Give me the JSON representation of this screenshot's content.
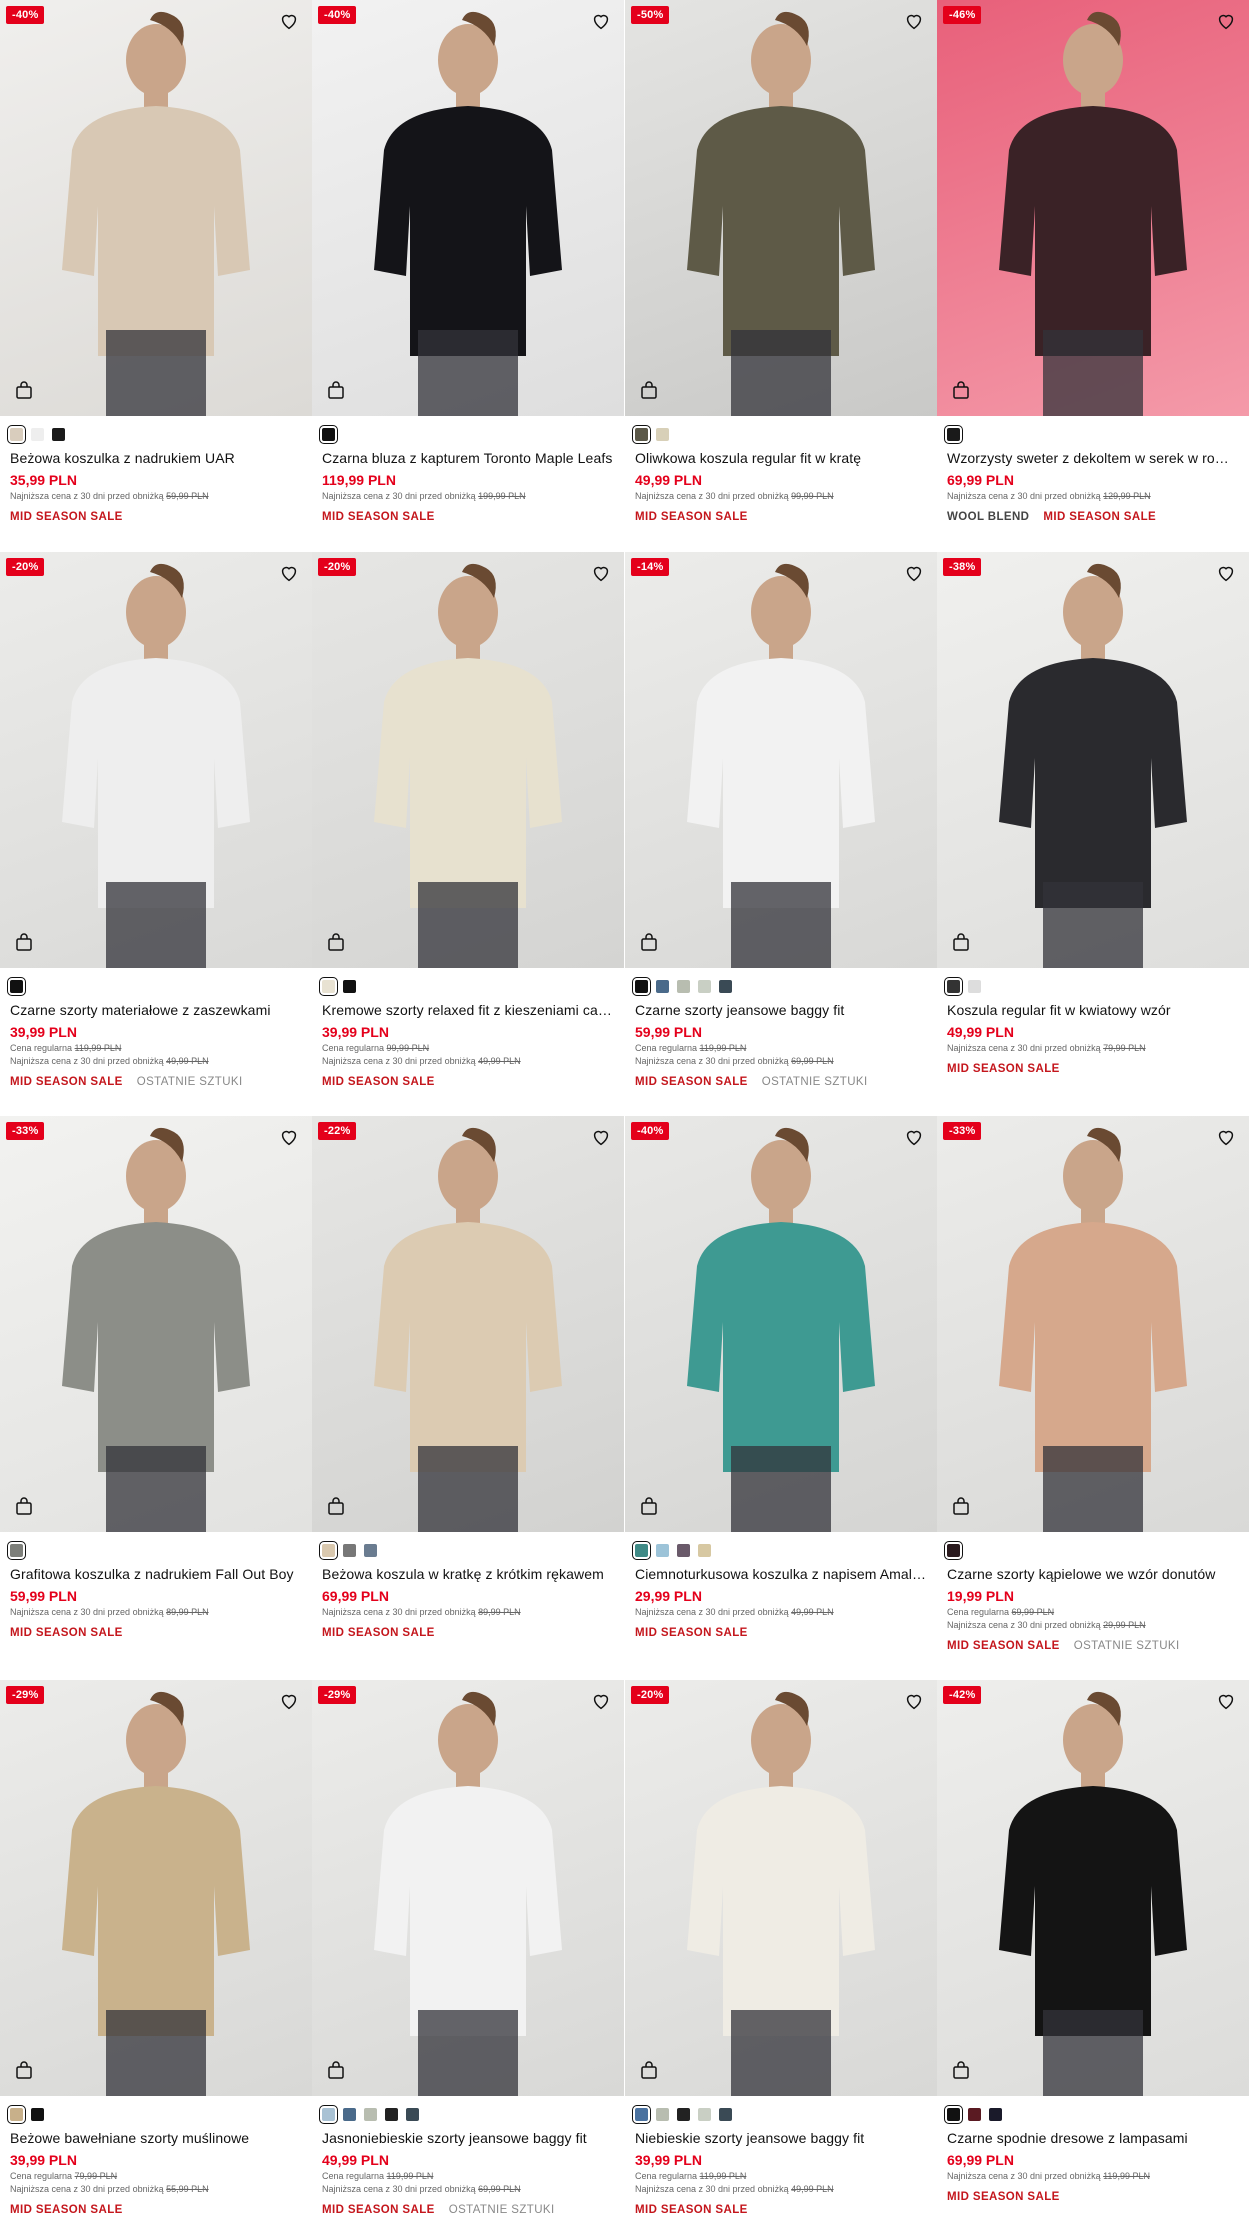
{
  "products": [
    {
      "discount": "-40%",
      "name": "Beżowa koszulka z nadrukiem UAR",
      "price": "35,99 PLN",
      "regular": "",
      "lowest_label": "Najniższa cena z 30 dni przed obniżką",
      "lowest": "59,99 PLN",
      "tags": [
        "MID SEASON SALE"
      ],
      "swatches": [
        "#d9cdbd",
        "#eeeeee",
        "#1a1a1a"
      ],
      "bg": "linear-gradient(160deg,#f0efed,#dcdad6)",
      "figure": "#d8c8b4"
    },
    {
      "discount": "-40%",
      "name": "Czarna bluza z kapturem Toronto Maple Leafs",
      "price": "119,99 PLN",
      "regular": "",
      "lowest_label": "Najniższa cena z 30 dni przed obniżką",
      "lowest": "199,99 PLN",
      "tags": [
        "MID SEASON SALE"
      ],
      "swatches": [
        "#111111"
      ],
      "bg": "linear-gradient(160deg,#f2f2f2,#dedede)",
      "figure": "#141418"
    },
    {
      "discount": "-50%",
      "name": "Oliwkowa koszula regular fit w kratę",
      "price": "49,99 PLN",
      "regular": "",
      "lowest_label": "Najniższa cena z 30 dni przed obniżką",
      "lowest": "99,99 PLN",
      "tags": [
        "MID SEASON SALE"
      ],
      "swatches": [
        "#5b5848",
        "#d8d0b8"
      ],
      "bg": "linear-gradient(160deg,#e4e4e2,#c9c9c7)",
      "figure": "#5e5a47"
    },
    {
      "discount": "-46%",
      "name": "Wzorzysty sweter z dekoltem w serek w ro…",
      "price": "69,99 PLN",
      "regular": "",
      "lowest_label": "Najniższa cena z 30 dni przed obniżką",
      "lowest": "129,99 PLN",
      "tags": [
        "WOOL BLEND",
        "MID SEASON SALE"
      ],
      "swatches": [
        "#1a1a1a"
      ],
      "bg": "linear-gradient(160deg,#e8607a,#f49aa9)",
      "figure": "#3a2226"
    },
    {
      "discount": "-20%",
      "name": "Czarne szorty materiałowe z zaszewkami",
      "price": "39,99 PLN",
      "regular": "119,99 PLN",
      "lowest_label": "Najniższa cena z 30 dni przed obniżką",
      "lowest": "49,99 PLN",
      "tags": [
        "MID SEASON SALE",
        "OSTATNIE SZTUKI"
      ],
      "swatches": [
        "#111111"
      ],
      "bg": "linear-gradient(160deg,#ececea,#d9d9d7)",
      "figure": "#eeeeee"
    },
    {
      "discount": "-20%",
      "name": "Kremowe szorty relaxed fit z kieszeniami car…",
      "price": "39,99 PLN",
      "regular": "99,99 PLN",
      "lowest_label": "Najniższa cena z 30 dni przed obniżką",
      "lowest": "49,99 PLN",
      "tags": [
        "MID SEASON SALE"
      ],
      "swatches": [
        "#e8e2d2",
        "#111111"
      ],
      "bg": "linear-gradient(160deg,#e6e6e4,#d4d4d2)",
      "figure": "#e7e1cf"
    },
    {
      "discount": "-14%",
      "name": "Czarne szorty jeansowe baggy fit",
      "price": "59,99 PLN",
      "regular": "119,99 PLN",
      "lowest_label": "Najniższa cena z 30 dni przed obniżką",
      "lowest": "69,99 PLN",
      "tags": [
        "MID SEASON SALE",
        "OSTATNIE SZTUKI"
      ],
      "swatches": [
        "#111111",
        "#4a6a8a",
        "#b8bdb0",
        "#c9cfc4",
        "#3a4a55"
      ],
      "bg": "linear-gradient(160deg,#ececea,#d8d8d6)",
      "figure": "#f2f2f2"
    },
    {
      "discount": "-38%",
      "name": "Koszula regular fit w kwiatowy wzór",
      "price": "49,99 PLN",
      "regular": "",
      "lowest_label": "Najniższa cena z 30 dni przed obniżką",
      "lowest": "79,99 PLN",
      "tags": [
        "MID SEASON SALE"
      ],
      "swatches": [
        "#333333",
        "#dddddd"
      ],
      "bg": "linear-gradient(160deg,#f0f0ee,#dededc)",
      "figure": "#2a2a2e"
    },
    {
      "discount": "-33%",
      "name": "Grafitowa koszulka z nadrukiem Fall Out Boy",
      "price": "59,99 PLN",
      "regular": "",
      "lowest_label": "Najniższa cena z 30 dni przed obniżką",
      "lowest": "89,99 PLN",
      "tags": [
        "MID SEASON SALE"
      ],
      "swatches": [
        "#7d7f7a"
      ],
      "bg": "linear-gradient(160deg,#f2f2f0,#e2e2e0)",
      "figure": "#8c8e88"
    },
    {
      "discount": "-22%",
      "name": "Beżowa koszula w kratkę z krótkim rękawem",
      "price": "69,99 PLN",
      "regular": "",
      "lowest_label": "Najniższa cena z 30 dni przed obniżką",
      "lowest": "89,99 PLN",
      "tags": [
        "MID SEASON SALE"
      ],
      "swatches": [
        "#d9c8ae",
        "#777777",
        "#6a7c90"
      ],
      "bg": "linear-gradient(160deg,#e6e6e4,#d2d2d0)",
      "figure": "#dccbb2"
    },
    {
      "discount": "-40%",
      "name": "Ciemnoturkusowa koszulka z napisem Amalf…",
      "price": "29,99 PLN",
      "regular": "",
      "lowest_label": "Najniższa cena z 30 dni przed obniżką",
      "lowest": "49,99 PLN",
      "tags": [
        "MID SEASON SALE"
      ],
      "swatches": [
        "#3f8a86",
        "#9cc3d8",
        "#6a5a6a",
        "#d7c8a2"
      ],
      "bg": "linear-gradient(160deg,#e8e8e6,#d5d5d3)",
      "figure": "#3e9a92"
    },
    {
      "discount": "-33%",
      "name": "Czarne szorty kąpielowe we wzór donutów",
      "price": "19,99 PLN",
      "regular": "69,99 PLN",
      "lowest_label": "Najniższa cena z 30 dni przed obniżką",
      "lowest": "29,99 PLN",
      "tags": [
        "MID SEASON SALE",
        "OSTATNIE SZTUKI"
      ],
      "swatches": [
        "#2a1a1e"
      ],
      "bg": "linear-gradient(160deg,#ececea,#d9d9d7)",
      "figure": "#d6a88c"
    },
    {
      "discount": "-29%",
      "name": "Beżowe bawełniane szorty muślinowe",
      "price": "39,99 PLN",
      "regular": "79,99 PLN",
      "lowest_label": "Najniższa cena z 30 dni przed obniżką",
      "lowest": "55,99 PLN",
      "tags": [
        "MID SEASON SALE"
      ],
      "swatches": [
        "#c8b08a",
        "#111111"
      ],
      "bg": "linear-gradient(160deg,#ececea,#d8d8d6)",
      "figure": "#c9b28c"
    },
    {
      "discount": "-29%",
      "name": "Jasnoniebieskie szorty jeansowe baggy fit",
      "price": "49,99 PLN",
      "regular": "119,99 PLN",
      "lowest_label": "Najniższa cena z 30 dni przed obniżką",
      "lowest": "69,99 PLN",
      "tags": [
        "MID SEASON SALE",
        "OSTATNIE SZTUKI"
      ],
      "swatches": [
        "#a9c2d4",
        "#4a6a8a",
        "#b8bdb0",
        "#222222",
        "#3a4a55"
      ],
      "bg": "linear-gradient(160deg,#ececea,#d8d8d6)",
      "figure": "#f2f2f2"
    },
    {
      "discount": "-20%",
      "name": "Niebieskie szorty jeansowe baggy fit",
      "price": "39,99 PLN",
      "regular": "119,99 PLN",
      "lowest_label": "Najniższa cena z 30 dni przed obniżką",
      "lowest": "49,99 PLN",
      "tags": [
        "MID SEASON SALE"
      ],
      "swatches": [
        "#4a72a0",
        "#b8bdb0",
        "#222222",
        "#c9cfc4",
        "#3a4a55"
      ],
      "bg": "linear-gradient(160deg,#ececea,#d8d8d6)",
      "figure": "#efece4"
    },
    {
      "discount": "-42%",
      "name": "Czarne spodnie dresowe z lampasami",
      "price": "69,99 PLN",
      "regular": "",
      "lowest_label": "Najniższa cena z 30 dni przed obniżką",
      "lowest": "119,99 PLN",
      "tags": [
        "MID SEASON SALE"
      ],
      "swatches": [
        "#111111",
        "#5a1a22",
        "#1a1a2a"
      ],
      "bg": "linear-gradient(160deg,#eeeeec,#dcdcda)",
      "figure": "#141414"
    }
  ],
  "regular_label": "Cena regularna",
  "colors": {
    "accent": "#e4001b",
    "tag": "#c4161c"
  }
}
